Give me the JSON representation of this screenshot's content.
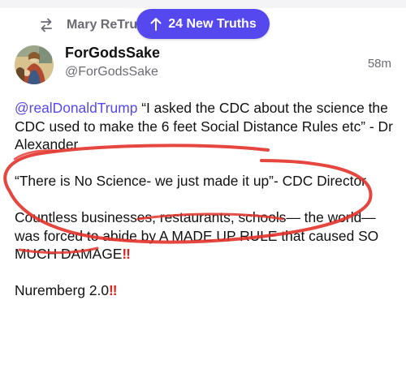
{
  "retruth": {
    "icon": "retruth-icon",
    "label": "Mary ReTru"
  },
  "new_truths_pill": {
    "icon": "arrow-up-icon",
    "label": "24 New Truths",
    "color": "#5448ee"
  },
  "author": {
    "name": "ForGodsSake",
    "handle": "@ForGodsSake",
    "avatar_icon": "painting-avatar"
  },
  "timestamp": "58m",
  "post": {
    "mention": "@realDonaldTrump",
    "line1_rest": " “I asked the CDC about the science the CDC used to make the 6 feet Social Distance Rules etc” - Dr Alexander",
    "quote": "“There is No Science- we just made it up”- CDC Director",
    "paragraph3": "Countless businesses, restaurants, schools— the world—was forced to abide by A MADE UP RULE that caused SO MUCH DAMAGE",
    "paragraph4": "Nuremberg 2.0",
    "emphasis": "‼",
    "mention_color": "#5448ee",
    "emphasis_color": "#e0201b"
  },
  "annotation": {
    "scribble_color": "#e2322a"
  }
}
